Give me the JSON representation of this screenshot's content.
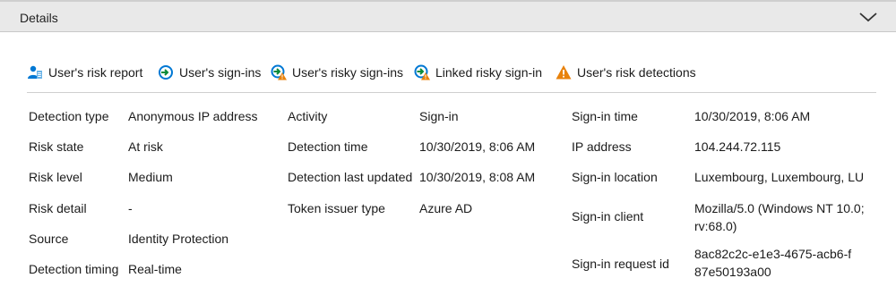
{
  "header": {
    "title": "Details"
  },
  "toolbar": {
    "items": [
      {
        "label": "User's risk report",
        "icon": "user-report-icon"
      },
      {
        "label": "User's sign-ins",
        "icon": "sign-in-icon"
      },
      {
        "label": "User's risky sign-ins",
        "icon": "risky-sign-in-icon"
      },
      {
        "label": "Linked risky sign-in",
        "icon": "linked-risky-sign-in-icon"
      },
      {
        "label": "User's risk detections",
        "icon": "warning-icon"
      }
    ]
  },
  "col1": [
    {
      "key": "Detection type",
      "value": "Anonymous IP address"
    },
    {
      "key": "Risk state",
      "value": "At risk"
    },
    {
      "key": "Risk level",
      "value": "Medium"
    },
    {
      "key": "Risk detail",
      "value": "-"
    },
    {
      "key": "Source",
      "value": "Identity Protection"
    },
    {
      "key": "Detection timing",
      "value": "Real-time"
    }
  ],
  "col2": [
    {
      "key": "Activity",
      "value": "Sign-in"
    },
    {
      "key": "Detection time",
      "value": "10/30/2019, 8:06 AM"
    },
    {
      "key": "Detection last updated",
      "value": "10/30/2019, 8:08 AM"
    },
    {
      "key": "Token issuer type",
      "value": "Azure AD"
    }
  ],
  "col3": [
    {
      "key": "Sign-in time",
      "value": "10/30/2019, 8:06 AM"
    },
    {
      "key": "IP address",
      "value": "104.244.72.115"
    },
    {
      "key": "Sign-in location",
      "value": "Luxembourg, Luxembourg, LU"
    },
    {
      "key": "Sign-in client",
      "value": "Mozilla/5.0 (Windows NT 10.0; rv:68.0)"
    },
    {
      "key": "Sign-in request id",
      "value": "8ac82c2c-e1e3-4675-acb6-f87e50193a00"
    }
  ],
  "colors": {
    "accent_blue": "#0078d4",
    "warning_orange": "#e8820c",
    "header_bg": "#e9e9e9"
  }
}
